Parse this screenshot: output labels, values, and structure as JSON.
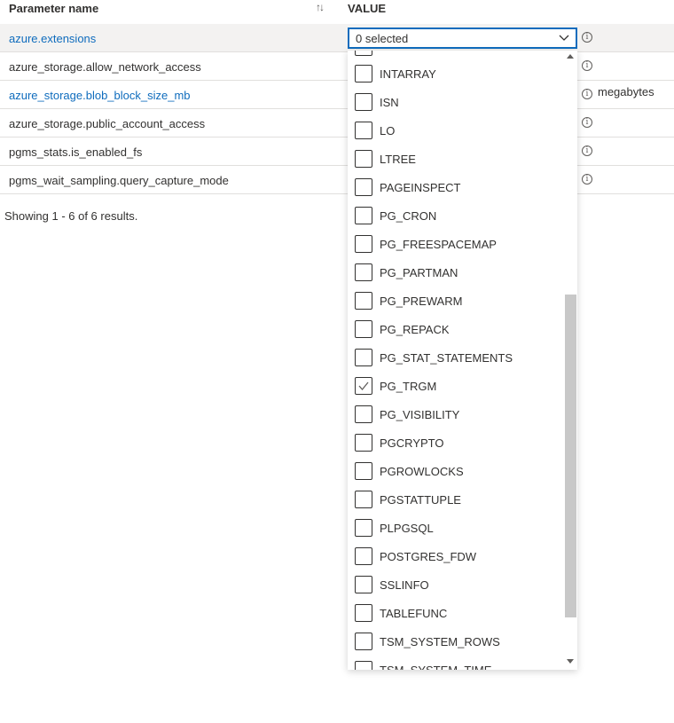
{
  "table": {
    "header": {
      "param_label": "Parameter name",
      "value_label": "VALUE"
    },
    "rows": [
      {
        "name": "azure.extensions",
        "link": true,
        "selected": true
      },
      {
        "name": "azure_storage.allow_network_access",
        "link": false
      },
      {
        "name": "azure_storage.blob_block_size_mb",
        "link": true,
        "unit": "megabytes"
      },
      {
        "name": "azure_storage.public_account_access",
        "link": false
      },
      {
        "name": "pgms_stats.is_enabled_fs",
        "link": false
      },
      {
        "name": "pgms_wait_sampling.query_capture_mode",
        "link": false
      }
    ],
    "footer": "Showing 1 - 6 of 6 results."
  },
  "dropdown": {
    "value": "0 selected",
    "options": [
      {
        "label": "INTARRAY",
        "checked": false
      },
      {
        "label": "ISN",
        "checked": false
      },
      {
        "label": "LO",
        "checked": false
      },
      {
        "label": "LTREE",
        "checked": false
      },
      {
        "label": "PAGEINSPECT",
        "checked": false
      },
      {
        "label": "PG_CRON",
        "checked": false
      },
      {
        "label": "PG_FREESPACEMAP",
        "checked": false
      },
      {
        "label": "PG_PARTMAN",
        "checked": false
      },
      {
        "label": "PG_PREWARM",
        "checked": false
      },
      {
        "label": "PG_REPACK",
        "checked": false
      },
      {
        "label": "PG_STAT_STATEMENTS",
        "checked": false
      },
      {
        "label": "PG_TRGM",
        "checked": true
      },
      {
        "label": "PG_VISIBILITY",
        "checked": false
      },
      {
        "label": "PGCRYPTO",
        "checked": false
      },
      {
        "label": "PGROWLOCKS",
        "checked": false
      },
      {
        "label": "PGSTATTUPLE",
        "checked": false
      },
      {
        "label": "PLPGSQL",
        "checked": false
      },
      {
        "label": "POSTGRES_FDW",
        "checked": false
      },
      {
        "label": "SSLINFO",
        "checked": false
      },
      {
        "label": "TABLEFUNC",
        "checked": false
      },
      {
        "label": "TSM_SYSTEM_ROWS",
        "checked": false
      },
      {
        "label": "TSM_SYSTEM_TIME",
        "checked": false
      }
    ]
  },
  "icons": {
    "sort": "sort-arrows-icon",
    "info": "info-icon",
    "chevron": "chevron-down-icon",
    "check": "checkmark-icon"
  },
  "colors": {
    "link": "#0f6cbd",
    "focus_border": "#0f6cbd",
    "selected_row": "#f3f2f1"
  }
}
